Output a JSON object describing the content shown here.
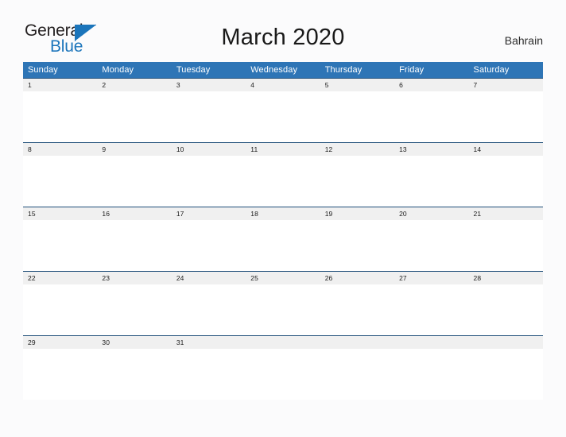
{
  "brand": {
    "name_part1": "General",
    "name_part2": "Blue",
    "flag_icon": "blue-flag-triangle",
    "color_dark": "#231f20",
    "color_blue": "#1b75bb"
  },
  "header": {
    "title": "March 2020",
    "month": "March",
    "year": "2020",
    "region": "Bahrain"
  },
  "colors": {
    "header_blue": "#2e75b6",
    "rule_blue": "#1f4e79",
    "daynum_band": "#f0f0f0",
    "cell_white": "#ffffff",
    "page_background": "#fbfbfc"
  },
  "calendar": {
    "weekday_headers": [
      "Sunday",
      "Monday",
      "Tuesday",
      "Wednesday",
      "Thursday",
      "Friday",
      "Saturday"
    ],
    "weeks": [
      {
        "days": [
          {
            "num": "1"
          },
          {
            "num": "2"
          },
          {
            "num": "3"
          },
          {
            "num": "4"
          },
          {
            "num": "5"
          },
          {
            "num": "6"
          },
          {
            "num": "7"
          }
        ]
      },
      {
        "days": [
          {
            "num": "8"
          },
          {
            "num": "9"
          },
          {
            "num": "10"
          },
          {
            "num": "11"
          },
          {
            "num": "12"
          },
          {
            "num": "13"
          },
          {
            "num": "14"
          }
        ]
      },
      {
        "days": [
          {
            "num": "15"
          },
          {
            "num": "16"
          },
          {
            "num": "17"
          },
          {
            "num": "18"
          },
          {
            "num": "19"
          },
          {
            "num": "20"
          },
          {
            "num": "21"
          }
        ]
      },
      {
        "days": [
          {
            "num": "22"
          },
          {
            "num": "23"
          },
          {
            "num": "24"
          },
          {
            "num": "25"
          },
          {
            "num": "26"
          },
          {
            "num": "27"
          },
          {
            "num": "28"
          }
        ]
      },
      {
        "days": [
          {
            "num": "29"
          },
          {
            "num": "30"
          },
          {
            "num": "31"
          },
          {
            "num": ""
          },
          {
            "num": ""
          },
          {
            "num": ""
          },
          {
            "num": ""
          }
        ]
      }
    ]
  }
}
